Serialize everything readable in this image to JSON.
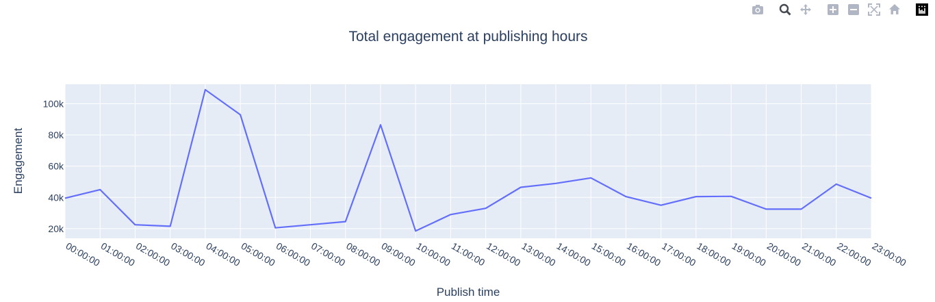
{
  "modebar": {
    "buttons": [
      "camera-icon",
      "zoom-icon",
      "pan-icon",
      "zoom-in-icon",
      "zoom-out-icon",
      "autoscale-icon",
      "reset-axes-icon",
      "plotly-logo-icon"
    ]
  },
  "colors": {
    "line": "#636efa",
    "plot_bg": "#e5ecf6",
    "grid": "#ffffff",
    "text": "#2a3f5f"
  },
  "chart_data": {
    "type": "line",
    "title": "Total engagement at publishing hours",
    "xlabel": "Publish time",
    "ylabel": "Engagement",
    "x": [
      "00:00:00",
      "01:00:00",
      "02:00:00",
      "03:00:00",
      "04:00:00",
      "05:00:00",
      "06:00:00",
      "07:00:00",
      "08:00:00",
      "09:00:00",
      "10:00:00",
      "11:00:00",
      "12:00:00",
      "13:00:00",
      "14:00:00",
      "15:00:00",
      "16:00:00",
      "17:00:00",
      "18:00:00",
      "19:00:00",
      "20:00:00",
      "21:00:00",
      "22:00:00",
      "23:00:00"
    ],
    "series": [
      {
        "values": [
          39500,
          45000,
          22500,
          21500,
          109000,
          93000,
          20500,
          22500,
          24500,
          86500,
          18500,
          29000,
          33000,
          46500,
          49000,
          52500,
          40500,
          35000,
          40500,
          40700,
          32500,
          32500,
          48500,
          39500
        ]
      }
    ],
    "yticks": [
      20000,
      40000,
      60000,
      80000,
      100000
    ],
    "ytick_labels": [
      "20k",
      "40k",
      "60k",
      "80k",
      "100k"
    ],
    "ylim": [
      13800,
      112500
    ],
    "grid": true,
    "legend": "none"
  }
}
